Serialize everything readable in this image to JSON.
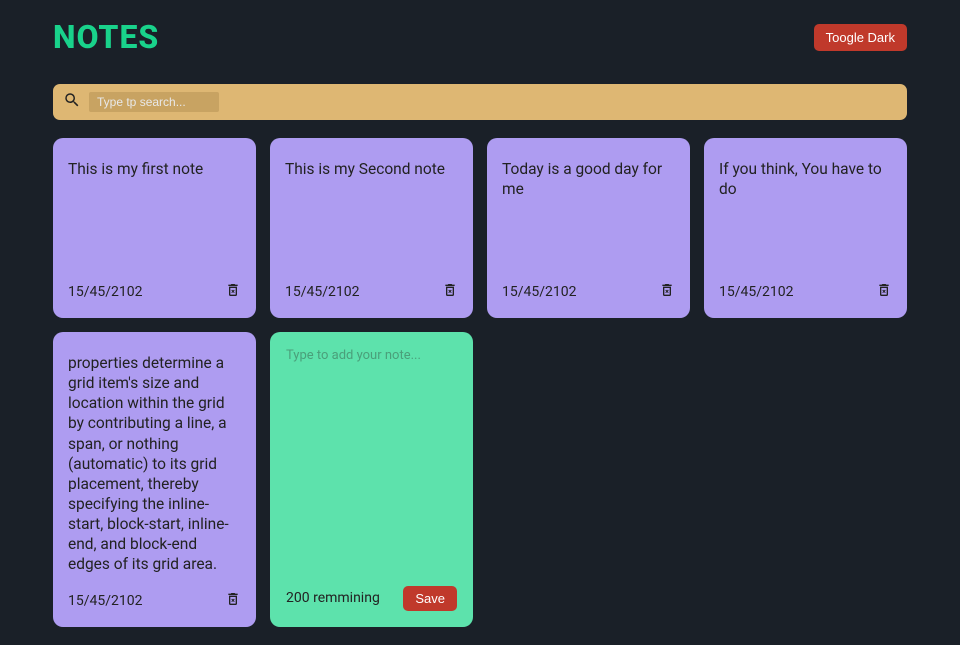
{
  "header": {
    "title": "NOTES",
    "toggle_label": "Toogle Dark"
  },
  "search": {
    "placeholder": "Type tp search..."
  },
  "notes": [
    {
      "text": "This is my first note",
      "date": "15/45/2102"
    },
    {
      "text": "This is my Second note",
      "date": "15/45/2102"
    },
    {
      "text": "Today is a good day for me",
      "date": "15/45/2102"
    },
    {
      "text": "If you think, You have to do",
      "date": "15/45/2102"
    },
    {
      "text": "properties determine a grid item's size and location within the grid by contributing a line, a span, or nothing (automatic) to its grid placement, thereby specifying the inline-start, block-start, inline-end, and block-end edges of its grid area.",
      "date": "15/45/2102"
    }
  ],
  "new_note": {
    "placeholder": "Type to add your note...",
    "remaining": "200 remmining",
    "save_label": "Save"
  }
}
